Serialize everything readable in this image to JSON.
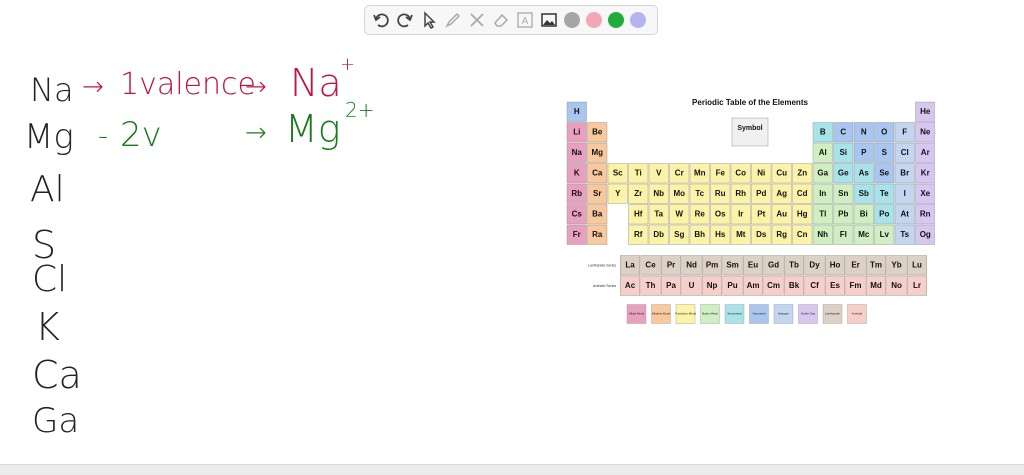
{
  "toolbar": {
    "tools": [
      "undo-icon",
      "redo-icon",
      "pointer-icon",
      "pen-icon",
      "tools-icon",
      "eraser-icon",
      "text-icon",
      "image-icon"
    ],
    "colors": [
      "#a6a6a6",
      "#f2a7b6",
      "#1fae3c",
      "#b3b3f0"
    ]
  },
  "notes": {
    "na": {
      "elem": "Na",
      "arrow1": "→",
      "valence": "1valence",
      "arrow2": "→",
      "ion": "Na",
      "charge": "+"
    },
    "mg": {
      "elem": "Mg",
      "dash": "-",
      "valence": "2v",
      "arrow": "→",
      "ion": "Mg",
      "charge": "2+"
    },
    "others": [
      "Al",
      "S",
      "Cl",
      "K",
      "Ca",
      "Ga"
    ]
  },
  "periodic_table": {
    "title": "Periodic Table of the Elements",
    "key_symbol": "Symbol",
    "rows": [
      [
        "H",
        "",
        "",
        "",
        "",
        "",
        "",
        "",
        "",
        "",
        "",
        "",
        "",
        "",
        "",
        "",
        "",
        "He"
      ],
      [
        "Li",
        "Be",
        "",
        "",
        "",
        "",
        "",
        "",
        "",
        "",
        "",
        "",
        "B",
        "C",
        "N",
        "O",
        "F",
        "Ne"
      ],
      [
        "Na",
        "Mg",
        "",
        "",
        "",
        "",
        "",
        "",
        "",
        "",
        "",
        "",
        "Al",
        "Si",
        "P",
        "S",
        "Cl",
        "Ar"
      ],
      [
        "K",
        "Ca",
        "Sc",
        "Ti",
        "V",
        "Cr",
        "Mn",
        "Fe",
        "Co",
        "Ni",
        "Cu",
        "Zn",
        "Ga",
        "Ge",
        "As",
        "Se",
        "Br",
        "Kr"
      ],
      [
        "Rb",
        "Sr",
        "Y",
        "Zr",
        "Nb",
        "Mo",
        "Tc",
        "Ru",
        "Rh",
        "Pd",
        "Ag",
        "Cd",
        "In",
        "Sn",
        "Sb",
        "Te",
        "I",
        "Xe"
      ],
      [
        "Cs",
        "Ba",
        "",
        "Hf",
        "Ta",
        "W",
        "Re",
        "Os",
        "Ir",
        "Pt",
        "Au",
        "Hg",
        "Tl",
        "Pb",
        "Bi",
        "Po",
        "At",
        "Rn"
      ],
      [
        "Fr",
        "Ra",
        "",
        "Rf",
        "Db",
        "Sg",
        "Bh",
        "Hs",
        "Mt",
        "Ds",
        "Rg",
        "Cn",
        "Nh",
        "Fl",
        "Mc",
        "Lv",
        "Ts",
        "Og"
      ]
    ],
    "lanthanides": [
      "La",
      "Ce",
      "Pr",
      "Nd",
      "Pm",
      "Sm",
      "Eu",
      "Gd",
      "Tb",
      "Dy",
      "Ho",
      "Er",
      "Tm",
      "Yb",
      "Lu"
    ],
    "actinides": [
      "Ac",
      "Th",
      "Pa",
      "U",
      "Np",
      "Pu",
      "Am",
      "Cm",
      "Bk",
      "Cf",
      "Es",
      "Fm",
      "Md",
      "No",
      "Lr"
    ],
    "series_labels": [
      "Lanthanide Series",
      "Actinide Series"
    ],
    "legend": [
      {
        "label": "Alkali Metal",
        "color": "#e8a0bf"
      },
      {
        "label": "Alkaline Earth",
        "color": "#f7c99c"
      },
      {
        "label": "Transition Metal",
        "color": "#fbf4a8"
      },
      {
        "label": "Basic Metal",
        "color": "#cfeec2"
      },
      {
        "label": "Semimetal",
        "color": "#a7e3e8"
      },
      {
        "label": "Nonmetal",
        "color": "#a9c7ee"
      },
      {
        "label": "Halogen",
        "color": "#c4d5f0"
      },
      {
        "label": "Noble Gas",
        "color": "#d7c6ef"
      },
      {
        "label": "Lanthanide",
        "color": "#ddd0c4"
      },
      {
        "label": "Actinide",
        "color": "#f5cfc8"
      }
    ]
  }
}
